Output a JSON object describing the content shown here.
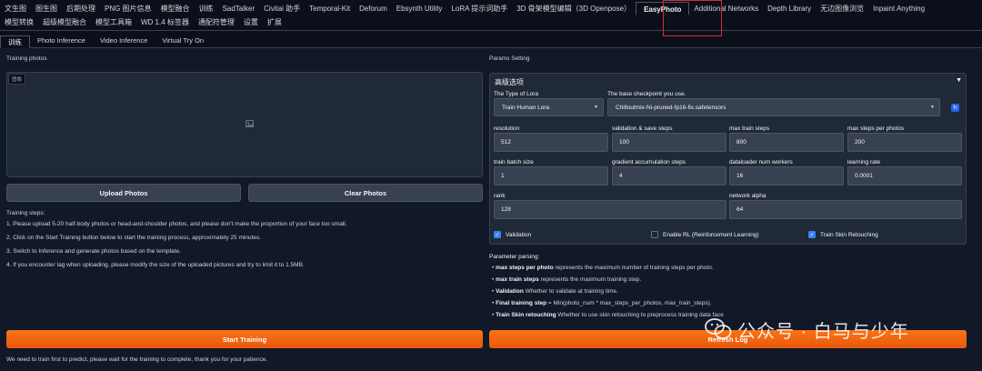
{
  "top_nav": {
    "row1": [
      "文生图",
      "图生图",
      "后期处理",
      "PNG 图片信息",
      "模型融合",
      "训练",
      "SadTalker",
      "Civitai 助手",
      "Temporal-Kit",
      "Deforum",
      "Ebsynth Utility",
      "LoRA 提示词助手",
      "3D 骨架模型编辑（3D Openpose）",
      "EasyPhoto",
      "Additional Networks",
      "Depth Library",
      "无边图像浏览",
      "Inpaint Anything"
    ],
    "row2": [
      "模型转换",
      "超级模型融合",
      "模型工具箱",
      "WD 1.4 标签器",
      "通配符管理",
      "设置",
      "扩展"
    ],
    "active": "EasyPhoto"
  },
  "sub_tabs": [
    "训练",
    "Photo Inference",
    "Video Inference",
    "Virtual Try On"
  ],
  "sub_tab_active": "训练",
  "left": {
    "training_photos_label": "Training photos",
    "dropzone_label": "图像",
    "dropzone_icon": "image-icon",
    "upload_label": "Upload Photos",
    "clear_label": "Clear Photos",
    "steps_header": "Training steps:",
    "steps": [
      "1. Please upload 5-20 half-body photos or head-and-shoulder photos, and please don't make the proportion of your face too small.",
      "2. Click on the Start Training button below to start the training process, approximately 25 minutes.",
      "3. Switch to Inference and generate photos based on the template.",
      "4. If you encounter lag when uploading, please modify the size of the uploaded pictures and try to limit it to 1.5MB."
    ],
    "start_label": "Start Training",
    "footer_note": "We need to train first to predict, please wait for the training to complete, thank you for your patience."
  },
  "right": {
    "params_label": "Params Setting",
    "advanced_title": "高级选项",
    "lora_type_label": "The Type of Lora",
    "lora_type_value": "Train Human Lora",
    "checkpoint_label": "The base checkpoint you use.",
    "checkpoint_value": "Chilloutmix-Ni-pruned-fp16-fix.safetensors",
    "fields": [
      {
        "label": "resolution",
        "value": "512"
      },
      {
        "label": "validation & save steps",
        "value": "100"
      },
      {
        "label": "max train steps",
        "value": "800"
      },
      {
        "label": "max steps per photos",
        "value": "200"
      },
      {
        "label": "train batch size",
        "value": "1"
      },
      {
        "label": "gradient accumulation steps",
        "value": "4"
      },
      {
        "label": "dataloader num workers",
        "value": "16"
      },
      {
        "label": "learning rate",
        "value": "0.0001"
      },
      {
        "label": "rank",
        "value": "128"
      },
      {
        "label": "network alpha",
        "value": "64"
      }
    ],
    "checkboxes": [
      {
        "label": "Validation",
        "checked": true
      },
      {
        "label": "Enable RL (Reinforcement Learning)",
        "checked": false
      },
      {
        "label": "Train Skin Retouching",
        "checked": true
      }
    ],
    "parsing_header": "Parameter parsing:",
    "parsing": [
      {
        "term": "max steps per photo",
        "desc": " represents the maximum number of training steps per photo."
      },
      {
        "term": "max train steps",
        "desc": " represents the maximum training step."
      },
      {
        "term": "Validation",
        "desc": " Whether to validate at training time."
      },
      {
        "term": "Final training step",
        "desc": " = Min(photo_num * max_steps_per_photos, max_train_steps)."
      },
      {
        "term": "Train Skin retouching",
        "desc": " Whether to use skin retouching to preprocess training data face"
      }
    ],
    "refresh_label": "Refresh Log"
  },
  "watermark": "公众号 · 白马与少年",
  "colors": {
    "accent_orange": "#f97316",
    "checkbox_blue": "#3b82f6",
    "highlight_red": "#d32f2f",
    "background": "#0b0f19",
    "panel": "#111827"
  }
}
